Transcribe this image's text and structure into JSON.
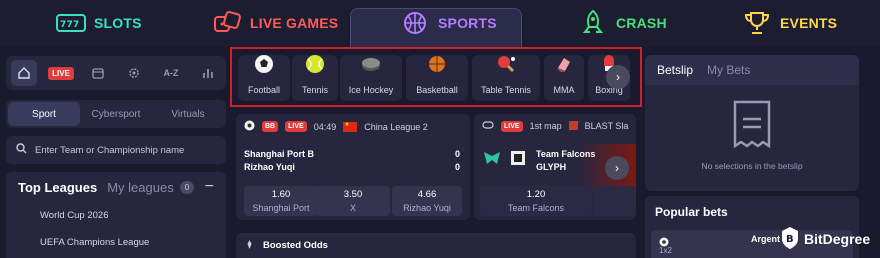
{
  "nav": {
    "items": [
      {
        "label": "SLOTS",
        "color": "#35e2c3",
        "icon": "slot-machine-icon"
      },
      {
        "label": "LIVE GAMES",
        "color": "#ff5a5a",
        "icon": "dice-icon"
      },
      {
        "label": "SPORTS",
        "color": "#b57cff",
        "icon": "basketball-icon"
      },
      {
        "label": "CRASH",
        "color": "#48e07a",
        "icon": "rocket-icon"
      },
      {
        "label": "EVENTS",
        "color": "#ffd54a",
        "icon": "trophy-icon"
      }
    ]
  },
  "sidebar": {
    "iconbar": [
      "home-icon",
      "LIVE",
      "calendar-icon",
      "gear-icon",
      "A-Z",
      "stats-icon"
    ],
    "segments": [
      "Sport",
      "Cybersport",
      "Virtuals"
    ],
    "search_placeholder": "Enter Team or Championship name",
    "leagues_title": "Top Leagues",
    "leagues_tab": "My leagues",
    "leagues_count": "0",
    "leagues": [
      "World Cup 2026",
      "UEFA Champions League"
    ]
  },
  "sports": [
    "Football",
    "Tennis",
    "Ice Hockey",
    "Basketball",
    "Table Tennis",
    "MMA",
    "Boxing"
  ],
  "matches": [
    {
      "time": "04:49",
      "league": "China League 2",
      "live": "LIVE",
      "bb": "BB",
      "team1": "Shanghai Port B",
      "team2": "Rizhao Yuqi",
      "score1": "0",
      "score2": "0",
      "odds": [
        {
          "value": "1.60",
          "label": "Shanghai Port"
        },
        {
          "value": "3.50",
          "label": "X"
        },
        {
          "value": "4.66",
          "label": "Rizhao Yuqi"
        }
      ]
    },
    {
      "live": "LIVE",
      "map": "1st map",
      "league": "BLAST Sla",
      "team1": "Team Falcons",
      "team2": "GLYPH",
      "odds": [
        {
          "value": "1.20",
          "label": "Team Falcons"
        }
      ]
    }
  ],
  "betslip": {
    "tab1": "Betslip",
    "tab2": "My Bets",
    "empty": "No selections in the betslip"
  },
  "popular": {
    "title": "Popular bets",
    "team": "Argent",
    "market": "1x2"
  },
  "boosted": "Boosted Odds",
  "watermark": "BitDegree"
}
